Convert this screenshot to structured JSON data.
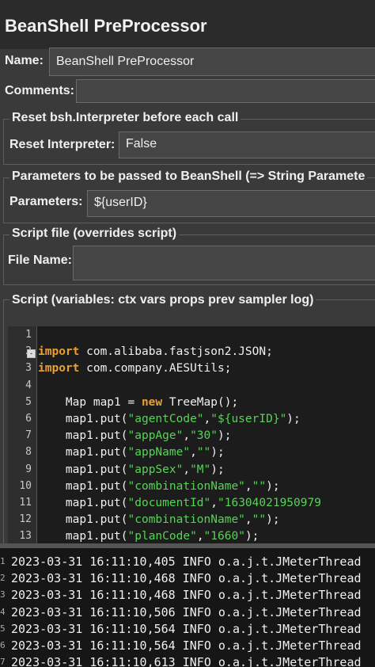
{
  "panel": {
    "title": "BeanShell PreProcessor"
  },
  "name_field": {
    "label": "Name:",
    "value": "BeanShell PreProcessor"
  },
  "comments_field": {
    "label": "Comments:"
  },
  "reset_group": {
    "legend": "Reset bsh.Interpreter before each call",
    "label": "Reset Interpreter:",
    "value": "False"
  },
  "params_group": {
    "legend": "Parameters to be passed to BeanShell (=> String Paramete",
    "label": "Parameters:",
    "value": "${userID}"
  },
  "file_group": {
    "legend": "Script file (overrides script)",
    "label": "File Name:",
    "value": ""
  },
  "script_group": {
    "legend": "Script (variables: ctx vars props prev sampler log)"
  },
  "editor": {
    "line_numbers": [
      "1",
      "2",
      "3",
      "4",
      "5",
      "6",
      "7",
      "8",
      "9",
      "10",
      "11",
      "12",
      "13"
    ],
    "lines": [
      {
        "kw": "",
        "text": ""
      },
      {
        "kw": "import",
        "text": " com.alibaba.fastjson2.JSON;"
      },
      {
        "kw": "import",
        "text": " com.company.AESUtils;"
      },
      {
        "kw": "",
        "text": ""
      },
      {
        "kw": "",
        "text": "    Map map1 = ",
        "kw2": "new",
        "text2": " TreeMap();"
      },
      {
        "text": "    map1.put(",
        "s1": "\"agentCode\"",
        "mid": ",",
        "s2": "\"${userID}\"",
        "end": ");"
      },
      {
        "text": "    map1.put(",
        "s1": "\"appAge\"",
        "mid": ",",
        "s2": "\"30\"",
        "end": ");"
      },
      {
        "text": "    map1.put(",
        "s1": "\"appName\"",
        "mid": ",",
        "s2": "\"\"",
        "end": ");"
      },
      {
        "text": "    map1.put(",
        "s1": "\"appSex\"",
        "mid": ",",
        "s2": "\"M\"",
        "end": ");"
      },
      {
        "text": "    map1.put(",
        "s1": "\"combinationName\"",
        "mid": ",",
        "s2": "\"\"",
        "end": ");"
      },
      {
        "text": "    map1.put(",
        "s1": "\"documentId\"",
        "mid": ",",
        "s2": "\"16304021950979",
        "end": ""
      },
      {
        "text": "    map1.put(",
        "s1": "\"combinationName\"",
        "mid": ",",
        "s2": "\"\"",
        "end": ");"
      },
      {
        "text": "    map1.put(",
        "s1": "\"planCode\"",
        "mid": ",",
        "s2": "\"1660\"",
        "end": ");"
      }
    ]
  },
  "log": {
    "line_numbers": [
      "1",
      "2",
      "3",
      "4",
      "5",
      "6",
      "7"
    ],
    "lines": [
      "2023-03-31 16:11:10,405 INFO o.a.j.t.JMeterThread",
      "2023-03-31 16:11:10,468 INFO o.a.j.t.JMeterThread",
      "2023-03-31 16:11:10,468 INFO o.a.j.t.JMeterThread",
      "2023-03-31 16:11:10,506 INFO o.a.j.t.JMeterThread",
      "2023-03-31 16:11:10,564 INFO o.a.j.t.JMeterThread",
      "2023-03-31 16:11:10,564 INFO o.a.j.t.JMeterThread",
      "2023-03-31 16:11:10,613 INFO o.a.j.t.JMeterThread"
    ]
  }
}
